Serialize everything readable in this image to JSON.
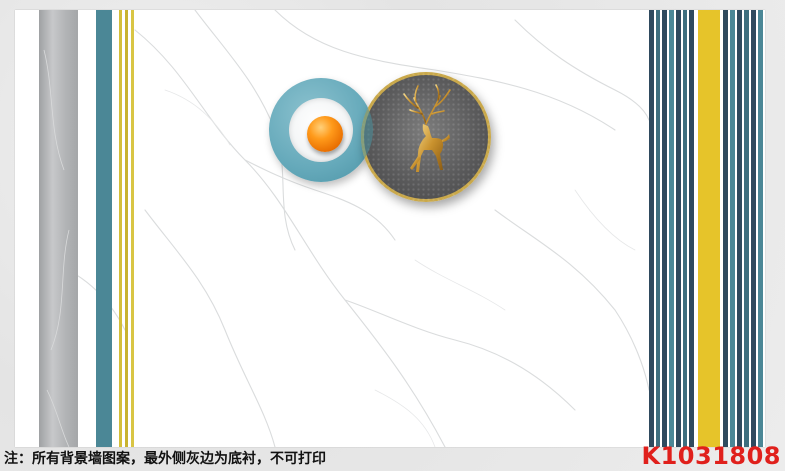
{
  "footer": {
    "note": "注：所有背景墙图案，最外侧灰边为底衬，不可打印",
    "product_code": "K1031808"
  },
  "colors": {
    "teal": "#4b8796",
    "dark_navy": "#2f4a5e",
    "gold": "#d4bf3a",
    "yellow": "#e6c42a",
    "grey": "#b1b3b5",
    "orange": "#ff9a1a",
    "code_red": "#e0201c"
  },
  "decor": {
    "icons": [
      "marble-texture",
      "orange-ball",
      "golden-deer",
      "teal-ring",
      "dark-disc"
    ]
  }
}
